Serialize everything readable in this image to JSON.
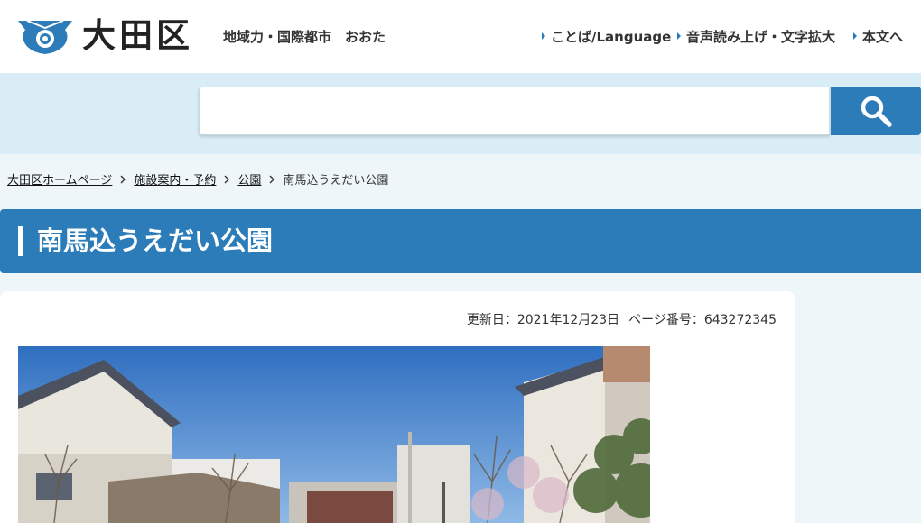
{
  "header": {
    "logo_text": "大田区",
    "tagline": "地域力・国際都市　おおた",
    "links": {
      "language": "ことば/Language",
      "voice": "音声読み上げ・文字拡大",
      "skip_to_main": "本文へ"
    }
  },
  "search": {
    "value": "",
    "placeholder": "",
    "icon": "search-icon"
  },
  "breadcrumb": {
    "items": [
      {
        "label": "大田区ホームページ"
      },
      {
        "label": "施設案内・予約"
      },
      {
        "label": "公園"
      }
    ],
    "current": "南馬込うえだい公園",
    "separator_icon": "chevron-right-icon"
  },
  "page": {
    "title": "南馬込うえだい公園",
    "updated": "更新日：2021年12月23日",
    "page_number": "ページ番号：643272345"
  },
  "colors": {
    "accent": "#2b7cb8",
    "band": "#d9edf7",
    "background": "#eef6fa"
  }
}
